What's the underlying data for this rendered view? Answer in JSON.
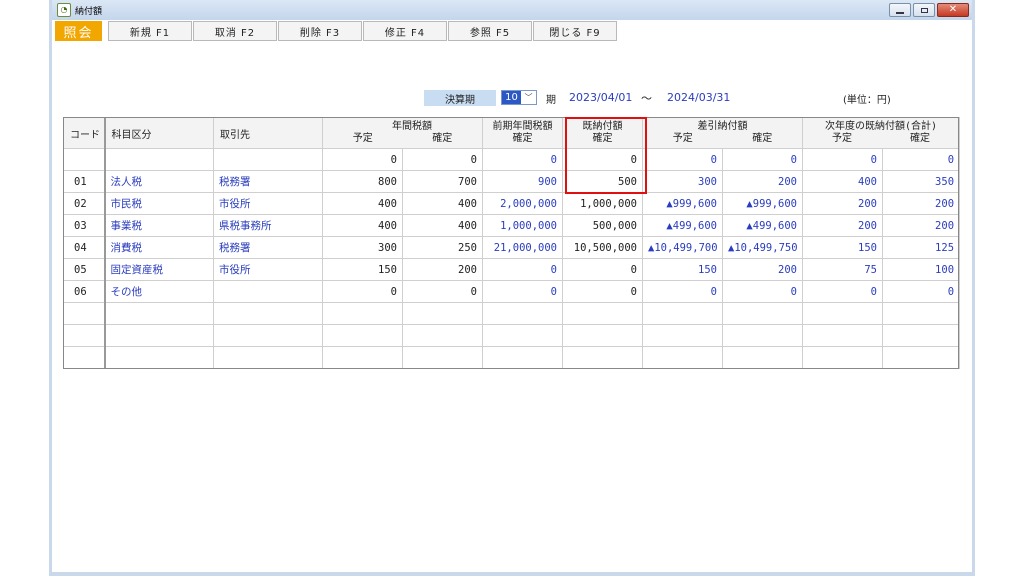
{
  "window": {
    "title": "納付額"
  },
  "toolbar": {
    "mode": "照会",
    "buttons": [
      "新規 F1",
      "取消 F2",
      "削除 F3",
      "修正 F4",
      "参照 F5",
      "閉じる F9"
    ]
  },
  "period": {
    "label": "決算期",
    "value": "10",
    "ki": "期",
    "start": "2023/04/01",
    "tilde": "～",
    "end": "2024/03/31",
    "unit": "(単位：円)"
  },
  "headers": {
    "code": "コード",
    "category": "科目区分",
    "partner": "取引先",
    "annual": "年間税額",
    "prev_annual": "前期年間税額",
    "paid": "既納付額",
    "diff": "差引納付額",
    "next_paid": "次年度の既納付額(合計)",
    "plan": "予定",
    "confirm": "確定"
  },
  "rows": [
    {
      "code": "",
      "category": "",
      "partner": "",
      "annual_plan": "0",
      "annual_confirm": "0",
      "prev": "0",
      "paid": "0",
      "diff_plan": "0",
      "diff_confirm": "0",
      "next_plan": "0",
      "next_confirm": "0"
    },
    {
      "code": "01",
      "category": "法人税",
      "partner": "税務署",
      "annual_plan": "800",
      "annual_confirm": "700",
      "prev": "900",
      "paid": "500",
      "diff_plan": "300",
      "diff_confirm": "200",
      "next_plan": "400",
      "next_confirm": "350"
    },
    {
      "code": "02",
      "category": "市民税",
      "partner": "市役所",
      "annual_plan": "400",
      "annual_confirm": "400",
      "prev": "2,000,000",
      "paid": "1,000,000",
      "diff_plan": "▲999,600",
      "diff_confirm": "▲999,600",
      "next_plan": "200",
      "next_confirm": "200"
    },
    {
      "code": "03",
      "category": "事業税",
      "partner": "県税事務所",
      "annual_plan": "400",
      "annual_confirm": "400",
      "prev": "1,000,000",
      "paid": "500,000",
      "diff_plan": "▲499,600",
      "diff_confirm": "▲499,600",
      "next_plan": "200",
      "next_confirm": "200"
    },
    {
      "code": "04",
      "category": "消費税",
      "partner": "税務署",
      "annual_plan": "300",
      "annual_confirm": "250",
      "prev": "21,000,000",
      "paid": "10,500,000",
      "diff_plan": "▲10,499,700",
      "diff_confirm": "▲10,499,750",
      "next_plan": "150",
      "next_confirm": "125"
    },
    {
      "code": "05",
      "category": "固定資産税",
      "partner": "市役所",
      "annual_plan": "150",
      "annual_confirm": "200",
      "prev": "0",
      "paid": "0",
      "diff_plan": "150",
      "diff_confirm": "200",
      "next_plan": "75",
      "next_confirm": "100"
    },
    {
      "code": "06",
      "category": "その他",
      "partner": "",
      "annual_plan": "0",
      "annual_confirm": "0",
      "prev": "0",
      "paid": "0",
      "diff_plan": "0",
      "diff_confirm": "0",
      "next_plan": "0",
      "next_confirm": "0"
    }
  ],
  "blank_rows": 3,
  "colors": {
    "accent": "#f2a600",
    "link_text": "#2a3dbf",
    "highlight": "#e01010",
    "period_label_bg": "#c8dcf2"
  }
}
